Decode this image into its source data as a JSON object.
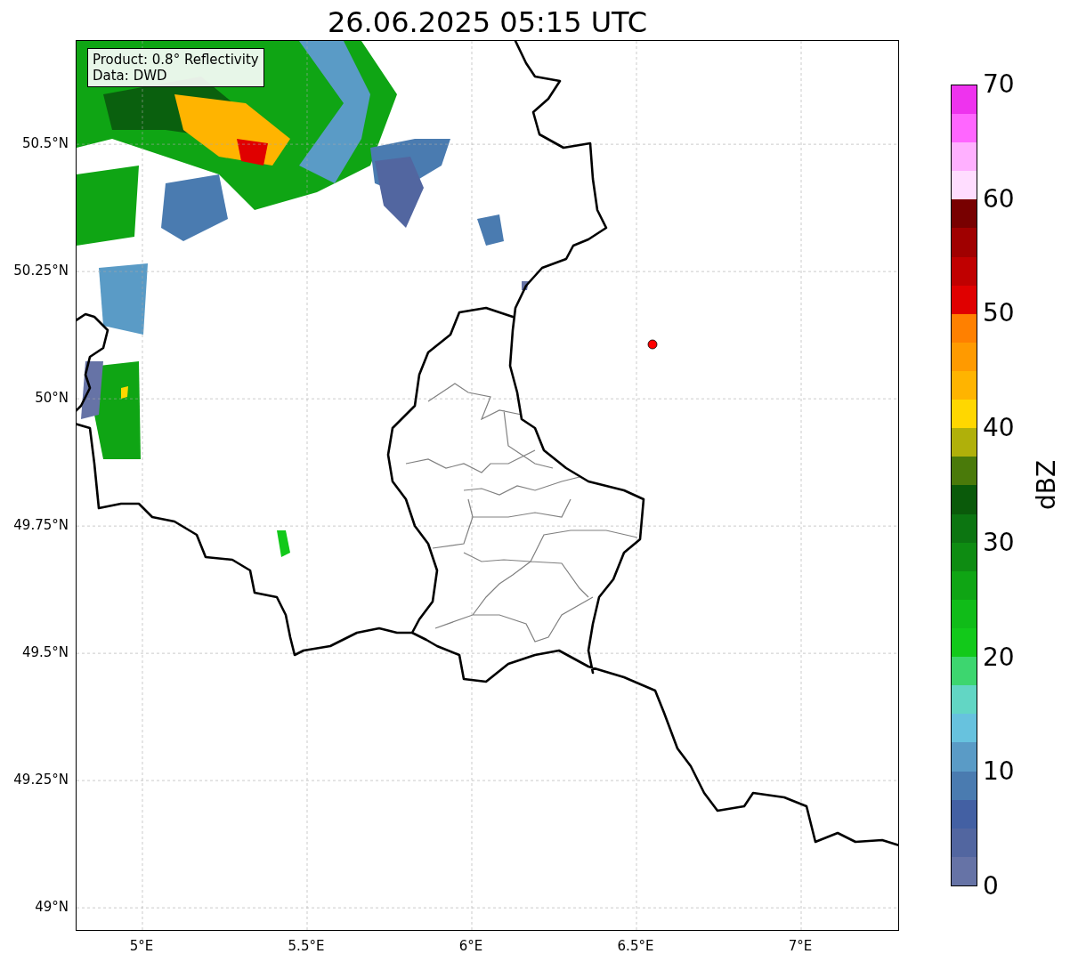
{
  "title": "26.06.2025 05:15 UTC",
  "legend": [
    "Product: 0.8° Reflectivity",
    "Data: DWD"
  ],
  "x_axis": {
    "ticks": [
      "5°E",
      "5.5°E",
      "6°E",
      "6.5°E",
      "7°E"
    ]
  },
  "y_axis": {
    "ticks": [
      "50.5°N",
      "50.25°N",
      "50°N",
      "49.75°N",
      "49.5°N",
      "49.25°N",
      "49°N"
    ]
  },
  "colorbar": {
    "label": "dBZ",
    "ticks": [
      "70",
      "60",
      "50",
      "40",
      "30",
      "20",
      "10",
      "0"
    ],
    "segments": [
      {
        "color": "#6673a6"
      },
      {
        "color": "#5266a0"
      },
      {
        "color": "#4360a3"
      },
      {
        "color": "#4a7bb0"
      },
      {
        "color": "#5a9bc6"
      },
      {
        "color": "#67c2de"
      },
      {
        "color": "#62d6c4"
      },
      {
        "color": "#3dd66f"
      },
      {
        "color": "#12c91a"
      },
      {
        "color": "#10bc18"
      },
      {
        "color": "#0fa514"
      },
      {
        "color": "#0e8c12"
      },
      {
        "color": "#0c7511"
      },
      {
        "color": "#0a5a0a"
      },
      {
        "color": "#4a7a0a"
      },
      {
        "color": "#b0b00a"
      },
      {
        "color": "#ffd700"
      },
      {
        "color": "#ffb400"
      },
      {
        "color": "#ff9a00"
      },
      {
        "color": "#ff8000"
      },
      {
        "color": "#e00000"
      },
      {
        "color": "#c00000"
      },
      {
        "color": "#a00000"
      },
      {
        "color": "#780000"
      },
      {
        "color": "#ffddff"
      },
      {
        "color": "#ffb0ff"
      },
      {
        "color": "#ff66ff"
      },
      {
        "color": "#ee33ee"
      }
    ]
  }
}
